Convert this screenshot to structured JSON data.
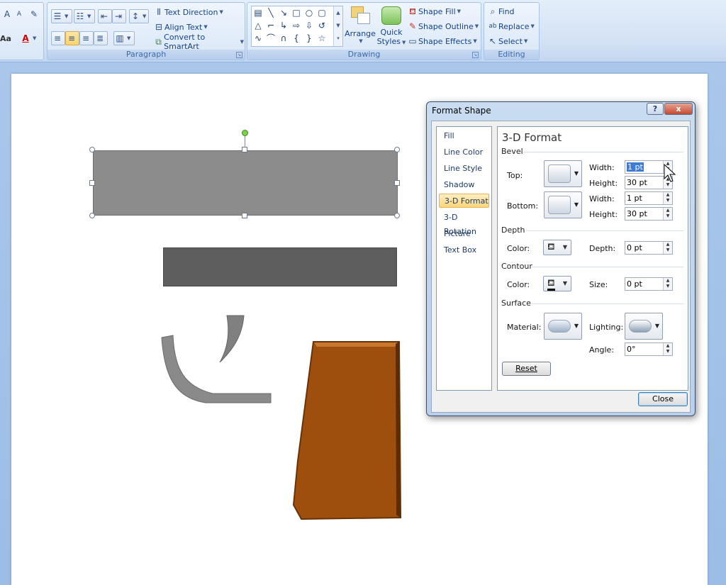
{
  "ribbon": {
    "paragraph": {
      "label": "Paragraph",
      "text_direction": "Text Direction",
      "align_text": "Align Text",
      "convert_smartart": "Convert to SmartArt"
    },
    "drawing": {
      "label": "Drawing",
      "arrange": "Arrange",
      "quick_styles_1": "Quick",
      "quick_styles_2": "Styles",
      "shape_fill": "Shape Fill",
      "shape_outline": "Shape Outline",
      "shape_effects": "Shape Effects"
    },
    "editing": {
      "label": "Editing",
      "find": "Find",
      "replace": "Replace",
      "select": "Select"
    },
    "font_partial": "Aa"
  },
  "dialog": {
    "title": "Format Shape",
    "help": "?",
    "close_x": "x",
    "categories": [
      "Fill",
      "Line Color",
      "Line Style",
      "Shadow",
      "3-D Format",
      "3-D Rotation",
      "Picture",
      "Text Box"
    ],
    "selected_category": "3-D Format",
    "panel_title": "3-D Format",
    "bevel": {
      "section": "Bevel",
      "top_label": "Top:",
      "bottom_label": "Bottom:",
      "width_label": "Width:",
      "height_label": "Height:",
      "top_width": "1 pt",
      "top_height": "30 pt",
      "bottom_width": "1 pt",
      "bottom_height": "30 pt"
    },
    "depth": {
      "section": "Depth",
      "color_label": "Color:",
      "depth_label": "Depth:",
      "depth_value": "0 pt"
    },
    "contour": {
      "section": "Contour",
      "color_label": "Color:",
      "size_label": "Size:",
      "size_value": "0 pt"
    },
    "surface": {
      "section": "Surface",
      "material_label": "Material:",
      "lighting_label": "Lighting:",
      "angle_label": "Angle:",
      "angle_value": "0°"
    },
    "reset_button": "Reset",
    "close_button": "Close"
  },
  "colors": {
    "selected_shape": "#8c8c8c",
    "dark_shape": "#5e5e5e",
    "brown_shape": "#a0500f",
    "highlight": "#fbd36b"
  }
}
